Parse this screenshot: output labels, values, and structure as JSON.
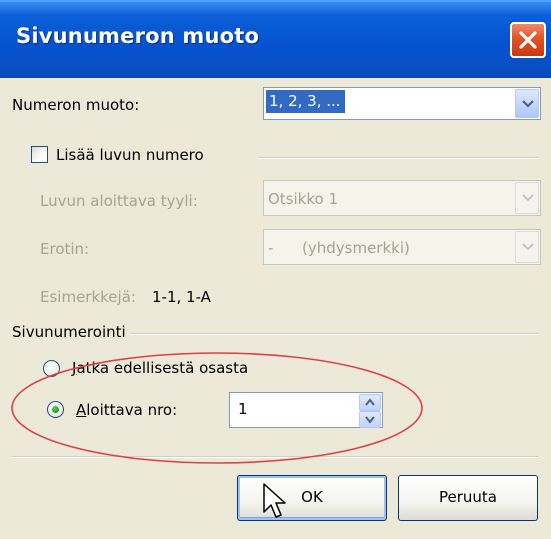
{
  "dialog": {
    "title": "Sivunumeron muoto",
    "close_icon": "close-icon"
  },
  "format": {
    "label": "Numeron muoto:",
    "value": "1, 2, 3, ..."
  },
  "chapter": {
    "checkbox_label": "Lisää luvun numero",
    "checked": false,
    "style_label": "Luvun aloittava tyyli:",
    "style_value": "Otsikko 1",
    "separator_label": "Erotin:",
    "separator_value": "-      (yhdysmerkki)",
    "examples_label": "Esimerkkejä:",
    "examples_value": "1-1, 1-A"
  },
  "numbering": {
    "group_label": "Sivunumerointi",
    "continue_label": "Jatka edellisestä osasta",
    "start_at_label": "Aloittava nro:",
    "start_at_value": "1",
    "selected": "start_at"
  },
  "buttons": {
    "ok": "OK",
    "cancel": "Peruuta"
  },
  "colors": {
    "title_bar": "#0553cf",
    "dialog_bg": "#ece9d8",
    "annotation": "#e04040"
  }
}
